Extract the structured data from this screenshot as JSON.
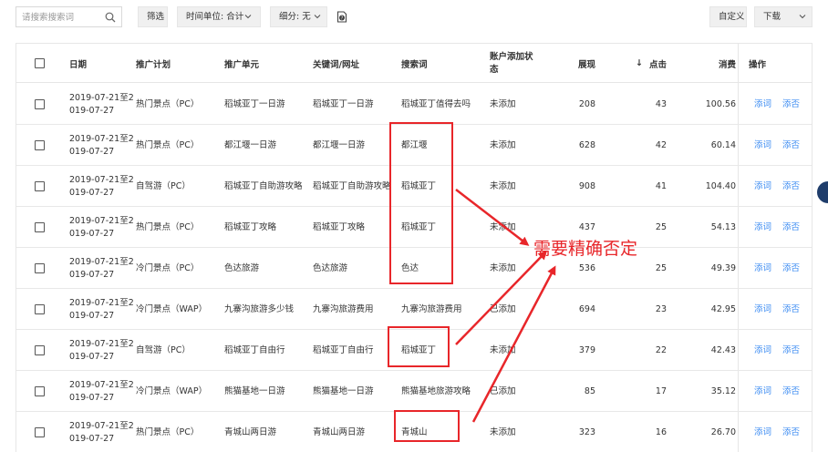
{
  "toolbar": {
    "search_placeholder": "请搜索搜索词",
    "filter_label": "筛选",
    "time_unit_label": "时间单位: 合计",
    "breakdown_label": "细分: 无",
    "customize_label": "自定义",
    "download_label": "下载"
  },
  "table": {
    "headers": {
      "date": "日期",
      "plan": "推广计划",
      "unit": "推广单元",
      "keyword": "关键词/网址",
      "search_term": "搜索词",
      "account_add_status": "账户添加状态",
      "impressions": "展现",
      "sort_arrow": "↓",
      "clicks": "点击",
      "cost": "消费",
      "actions": "操作"
    },
    "rows": [
      {
        "date1": "2019-07-21至2",
        "date2": "019-07-27",
        "plan": "热门景点（PC）",
        "unit": "稻城亚丁一日游",
        "keyword": "稻城亚丁一日游",
        "term": "稻城亚丁值得去吗",
        "status": "未添加",
        "impr": "208",
        "clicks": "43",
        "cost": "100.56",
        "act1": "添词",
        "act2": "添否"
      },
      {
        "date1": "2019-07-21至2",
        "date2": "019-07-27",
        "plan": "热门景点（PC）",
        "unit": "都江堰一日游",
        "keyword": "都江堰一日游",
        "term": "都江堰",
        "status": "未添加",
        "impr": "628",
        "clicks": "42",
        "cost": "60.14",
        "act1": "添词",
        "act2": "添否"
      },
      {
        "date1": "2019-07-21至2",
        "date2": "019-07-27",
        "plan": "自驾游（PC）",
        "unit": "稻城亚丁自助游攻略",
        "keyword": "稻城亚丁自助游攻略",
        "term": "稻城亚丁",
        "status": "未添加",
        "impr": "908",
        "clicks": "41",
        "cost": "104.40",
        "act1": "添词",
        "act2": "添否"
      },
      {
        "date1": "2019-07-21至2",
        "date2": "019-07-27",
        "plan": "热门景点（PC）",
        "unit": "稻城亚丁攻略",
        "keyword": "稻城亚丁攻略",
        "term": "稻城亚丁",
        "status": "未添加",
        "impr": "437",
        "clicks": "25",
        "cost": "54.13",
        "act1": "添词",
        "act2": "添否"
      },
      {
        "date1": "2019-07-21至2",
        "date2": "019-07-27",
        "plan": "冷门景点（PC）",
        "unit": "色达旅游",
        "keyword": "色达旅游",
        "term": "色达",
        "status": "未添加",
        "impr": "536",
        "clicks": "25",
        "cost": "49.39",
        "act1": "添词",
        "act2": "添否"
      },
      {
        "date1": "2019-07-21至2",
        "date2": "019-07-27",
        "plan": "冷门景点（WAP）",
        "unit": "九寨沟旅游多少钱",
        "keyword": "九寨沟旅游费用",
        "term": "九寨沟旅游费用",
        "status": "已添加",
        "impr": "694",
        "clicks": "23",
        "cost": "42.95",
        "act1": "添词",
        "act2": "添否"
      },
      {
        "date1": "2019-07-21至2",
        "date2": "019-07-27",
        "plan": "自驾游（PC）",
        "unit": "稻城亚丁自由行",
        "keyword": "稻城亚丁自由行",
        "term": "稻城亚丁",
        "status": "未添加",
        "impr": "379",
        "clicks": "22",
        "cost": "42.43",
        "act1": "添词",
        "act2": "添否"
      },
      {
        "date1": "2019-07-21至2",
        "date2": "019-07-27",
        "plan": "冷门景点（WAP）",
        "unit": "熊猫基地一日游",
        "keyword": "熊猫基地一日游",
        "term": "熊猫基地旅游攻略",
        "status": "已添加",
        "impr": "85",
        "clicks": "17",
        "cost": "35.12",
        "act1": "添词",
        "act2": "添否"
      },
      {
        "date1": "2019-07-21至2",
        "date2": "019-07-27",
        "plan": "热门景点（PC）",
        "unit": "青城山两日游",
        "keyword": "青城山两日游",
        "term": "青城山",
        "status": "未添加",
        "impr": "323",
        "clicks": "16",
        "cost": "26.70",
        "act1": "添词",
        "act2": "添否"
      }
    ]
  },
  "annotation": {
    "note": "需要精确否定",
    "color": "#e8262a"
  },
  "colors": {
    "link": "#3d8cf2",
    "border": "#e6e6e6",
    "button_bg": "#f0f0f0"
  },
  "icons": {
    "search": "search-icon",
    "chevron": "chevron-down-icon",
    "help": "help-doc-icon"
  }
}
